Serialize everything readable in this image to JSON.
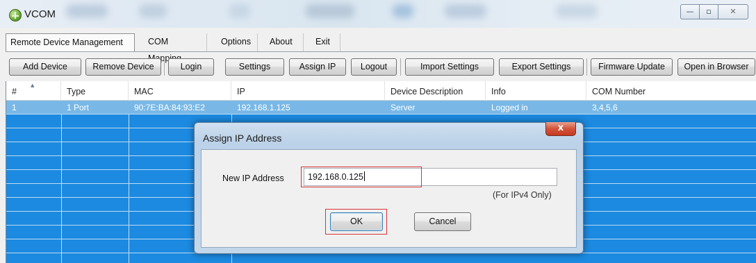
{
  "window": {
    "title": "VCOM",
    "controls": {
      "minimize": "—",
      "maximize": "▫",
      "close": "✕"
    }
  },
  "menu": [
    {
      "label": "Remote Device Management"
    },
    {
      "label": "COM Mapping"
    },
    {
      "label": "Options"
    },
    {
      "label": "About"
    },
    {
      "label": "Exit"
    }
  ],
  "toolbar": [
    {
      "label": "Add Device"
    },
    {
      "label": "Remove Device"
    },
    {
      "label": "Login"
    },
    {
      "label": "Settings"
    },
    {
      "label": "Assign IP"
    },
    {
      "label": "Logout"
    },
    {
      "label": "Import Settings"
    },
    {
      "label": "Export Settings"
    },
    {
      "label": "Firmware Update"
    },
    {
      "label": "Open in Browser"
    }
  ],
  "table": {
    "columns": [
      "#",
      "Type",
      "MAC",
      "IP",
      "Device Description",
      "Info",
      "COM Number"
    ],
    "rows": [
      [
        "1",
        "1 Port",
        "90:7E:BA:84:93:E2",
        "192.168.1.125",
        "Server",
        "Logged in",
        "3,4,5,6"
      ]
    ],
    "selected_row": 0
  },
  "dialog": {
    "title": "Assign IP Address",
    "close_label": "x",
    "field_label": "New IP Address",
    "ip_value": "192.168.0.125",
    "hint": "(For IPv4 Only)",
    "ok_label": "OK",
    "cancel_label": "Cancel"
  },
  "colors": {
    "table_fill": "#1c8ae0",
    "selected_row": "#79b8e6",
    "highlight": "#d8343a"
  }
}
